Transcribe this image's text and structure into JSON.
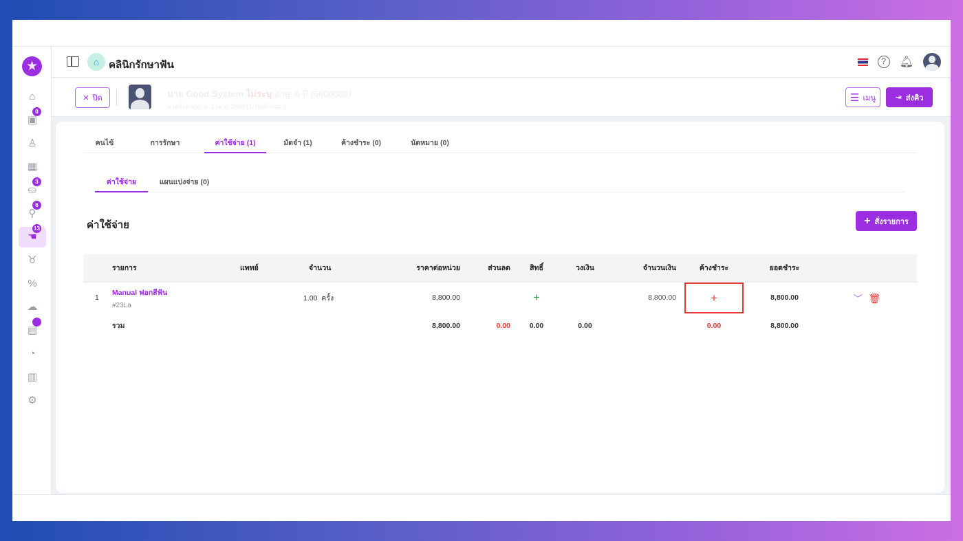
{
  "app": {
    "clinic_name": "คลินิกรักษาฟัน",
    "language_flag": "th"
  },
  "sidebar": {
    "items": [
      {
        "icon": "home-icon",
        "glyph": "⌂"
      },
      {
        "icon": "calendar-icon",
        "glyph": "▣",
        "badge": "0"
      },
      {
        "icon": "user-icon",
        "glyph": "♙"
      },
      {
        "icon": "queue-board-icon",
        "glyph": "▦"
      },
      {
        "icon": "treatment-icon",
        "glyph": "⛀",
        "badge": "3"
      },
      {
        "icon": "lab-tools-icon",
        "glyph": "⚲",
        "badge": "6"
      },
      {
        "icon": "payment-hand-icon",
        "glyph": "☚",
        "badge": "13",
        "active": true
      },
      {
        "icon": "tooth-icon",
        "glyph": "♉"
      },
      {
        "icon": "discount-icon",
        "glyph": "%"
      },
      {
        "icon": "cloud-icon",
        "glyph": "☁"
      },
      {
        "icon": "inventory-icon",
        "glyph": "▤",
        "badge": " "
      },
      {
        "icon": "dashboard-gauge-icon",
        "glyph": "◔"
      },
      {
        "icon": "report-chart-icon",
        "glyph": "▥"
      },
      {
        "icon": "settings-icon",
        "glyph": "⚙"
      }
    ]
  },
  "patient": {
    "close_label": "ปิด",
    "name": "นาย Good System",
    "gender": "ไม่ระบุ",
    "age": "อายุ: 6 ปี (6600080)",
    "last_visit": "มาครั้งล่าสุด: อ. 1 เม.ย. 2568 (1 วันที่ผ่านมา)",
    "menu_label": "เมนู",
    "send_queue_label": "ส่งคิว"
  },
  "tabs": [
    {
      "label": "คนไข้"
    },
    {
      "label": "การรักษา"
    },
    {
      "label": "ค่าใช้จ่าย (1)",
      "active": true
    },
    {
      "label": "มัดจำ (1)"
    },
    {
      "label": "ค้างชำระ (0)"
    },
    {
      "label": "นัดหมาย (0)"
    }
  ],
  "subtabs": [
    {
      "label": "ค่าใช้จ่าย",
      "active": true
    },
    {
      "label": "แผนแบ่งจ่าย (0)"
    }
  ],
  "section": {
    "title": "ค่าใช้จ่าย",
    "add_button": "สั่งรายการ"
  },
  "table": {
    "headers": [
      "รายการ",
      "แพทย์",
      "จำนวน",
      "ราคาต่อหน่วย",
      "ส่วนลด",
      "สิทธิ์",
      "วงเงิน",
      "จำนวนเงิน",
      "ค้างชำระ",
      "ยอดชำระ"
    ],
    "rows": [
      {
        "no": "1",
        "item": "Manual ฟอกสีฟัน",
        "code": "#23La",
        "doctor": "",
        "qty": "1.00",
        "unit": "ครั้ง",
        "unit_price": "8,800.00",
        "discount": "",
        "right": "+",
        "limit": "",
        "amount": "8,800.00",
        "outstanding": "+",
        "paid": "8,800.00"
      }
    ],
    "total": {
      "label": "รวม",
      "unit_price": "8,800.00",
      "discount": "0.00",
      "right": "0.00",
      "limit": "0.00",
      "outstanding": "0.00",
      "paid": "8,800.00"
    }
  },
  "colors": {
    "accent": "#9b2ee0",
    "danger": "#e53935",
    "success": "#2e9a4e"
  }
}
